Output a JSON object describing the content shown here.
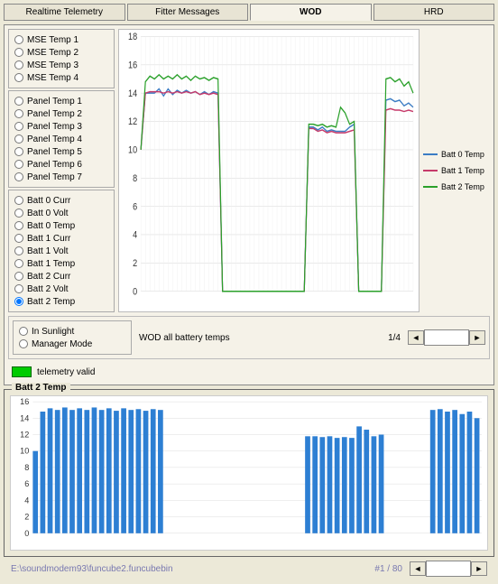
{
  "tabs": {
    "t0": "Realtime Telemetry",
    "t1": "Fitter Messages",
    "t2": "WOD",
    "t3": "HRD",
    "active": "WOD"
  },
  "groups": {
    "mse": [
      "MSE Temp 1",
      "MSE Temp 2",
      "MSE Temp 3",
      "MSE Temp 4"
    ],
    "panel": [
      "Panel Temp 1",
      "Panel Temp 2",
      "Panel Temp 3",
      "Panel Temp 4",
      "Panel Temp 5",
      "Panel Temp 6",
      "Panel Temp 7"
    ],
    "batt": [
      "Batt 0 Curr",
      "Batt 0 Volt",
      "Batt 0 Temp",
      "Batt 1 Curr",
      "Batt 1 Volt",
      "Batt 1 Temp",
      "Batt 2 Curr",
      "Batt 2 Volt",
      "Batt 2 Temp"
    ],
    "mode": [
      "In Sunlight",
      "Manager Mode"
    ]
  },
  "caption": "WOD all battery temps",
  "pager_main": "1/4",
  "status": "telemetry valid",
  "bottom_chart_title": "Batt 2 Temp",
  "footer_path": "E:\\soundmodem93\\funcube2.funcubebin",
  "footer_pager": "#1 / 80",
  "legend": {
    "a": "Batt 0 Temp",
    "b": "Batt 1 Temp",
    "c": "Batt 2 Temp"
  },
  "colors": {
    "s0": "#3b7cc4",
    "s1": "#c63a6a",
    "s2": "#2aa02a",
    "bar": "#2d7fd3"
  },
  "chart_data": {
    "top": {
      "type": "line",
      "title": "WOD all battery temps",
      "ylabel": "",
      "xlabel": "",
      "ylim": [
        0,
        18
      ],
      "yticks": [
        0,
        2,
        4,
        6,
        8,
        10,
        12,
        14,
        16,
        18
      ],
      "series": [
        {
          "name": "Batt 0 Temp",
          "color": "#3b7cc4",
          "values": [
            10,
            14,
            14,
            14,
            14.3,
            13.8,
            14.3,
            13.9,
            14.2,
            14,
            14.2,
            14,
            14.1,
            13.9,
            14.1,
            13.9,
            14.1,
            14,
            0,
            0,
            0,
            0,
            0,
            0,
            0,
            0,
            0,
            0,
            0,
            0,
            0,
            0,
            0,
            0,
            0,
            0,
            0,
            11.6,
            11.6,
            11.4,
            11.6,
            11.3,
            11.4,
            11.3,
            11.3,
            11.3,
            11.6,
            11.8,
            0,
            0,
            0,
            0,
            0,
            0,
            13.5,
            13.6,
            13.4,
            13.5,
            13.1,
            13.3,
            13
          ]
        },
        {
          "name": "Batt 1 Temp",
          "color": "#c63a6a",
          "values": [
            10,
            14,
            14.1,
            14.1,
            14.1,
            14,
            14.1,
            14,
            14.1,
            14,
            14.1,
            14,
            14.1,
            13.9,
            14,
            13.9,
            14,
            13.9,
            0,
            0,
            0,
            0,
            0,
            0,
            0,
            0,
            0,
            0,
            0,
            0,
            0,
            0,
            0,
            0,
            0,
            0,
            0,
            11.5,
            11.5,
            11.3,
            11.4,
            11.2,
            11.3,
            11.2,
            11.2,
            11.2,
            11.3,
            11.4,
            0,
            0,
            0,
            0,
            0,
            0,
            12.8,
            12.9,
            12.8,
            12.8,
            12.7,
            12.8,
            12.7
          ]
        },
        {
          "name": "Batt 2 Temp",
          "color": "#2aa02a",
          "values": [
            10,
            14.8,
            15.2,
            15,
            15.3,
            15,
            15.2,
            15,
            15.3,
            15,
            15.2,
            14.9,
            15.2,
            15,
            15.1,
            14.9,
            15.1,
            15,
            0,
            0,
            0,
            0,
            0,
            0,
            0,
            0,
            0,
            0,
            0,
            0,
            0,
            0,
            0,
            0,
            0,
            0,
            0,
            11.8,
            11.8,
            11.7,
            11.8,
            11.6,
            11.7,
            11.6,
            13,
            12.6,
            11.8,
            12,
            0,
            0,
            0,
            0,
            0,
            0,
            15,
            15.1,
            14.8,
            15,
            14.5,
            14.8,
            14
          ]
        }
      ]
    },
    "bottom": {
      "type": "bar",
      "title": "Batt 2 Temp",
      "ylim": [
        0,
        16
      ],
      "yticks": [
        0,
        2,
        4,
        6,
        8,
        10,
        12,
        14,
        16
      ],
      "values": [
        10,
        14.8,
        15.2,
        15,
        15.3,
        15,
        15.2,
        15,
        15.3,
        15,
        15.2,
        14.9,
        15.2,
        15,
        15.1,
        14.9,
        15.1,
        15,
        0,
        0,
        0,
        0,
        0,
        0,
        0,
        0,
        0,
        0,
        0,
        0,
        0,
        0,
        0,
        0,
        0,
        0,
        0,
        11.8,
        11.8,
        11.7,
        11.8,
        11.6,
        11.7,
        11.6,
        13,
        12.6,
        11.8,
        12,
        0,
        0,
        0,
        0,
        0,
        0,
        15,
        15.1,
        14.8,
        15,
        14.5,
        14.8,
        14
      ]
    }
  }
}
